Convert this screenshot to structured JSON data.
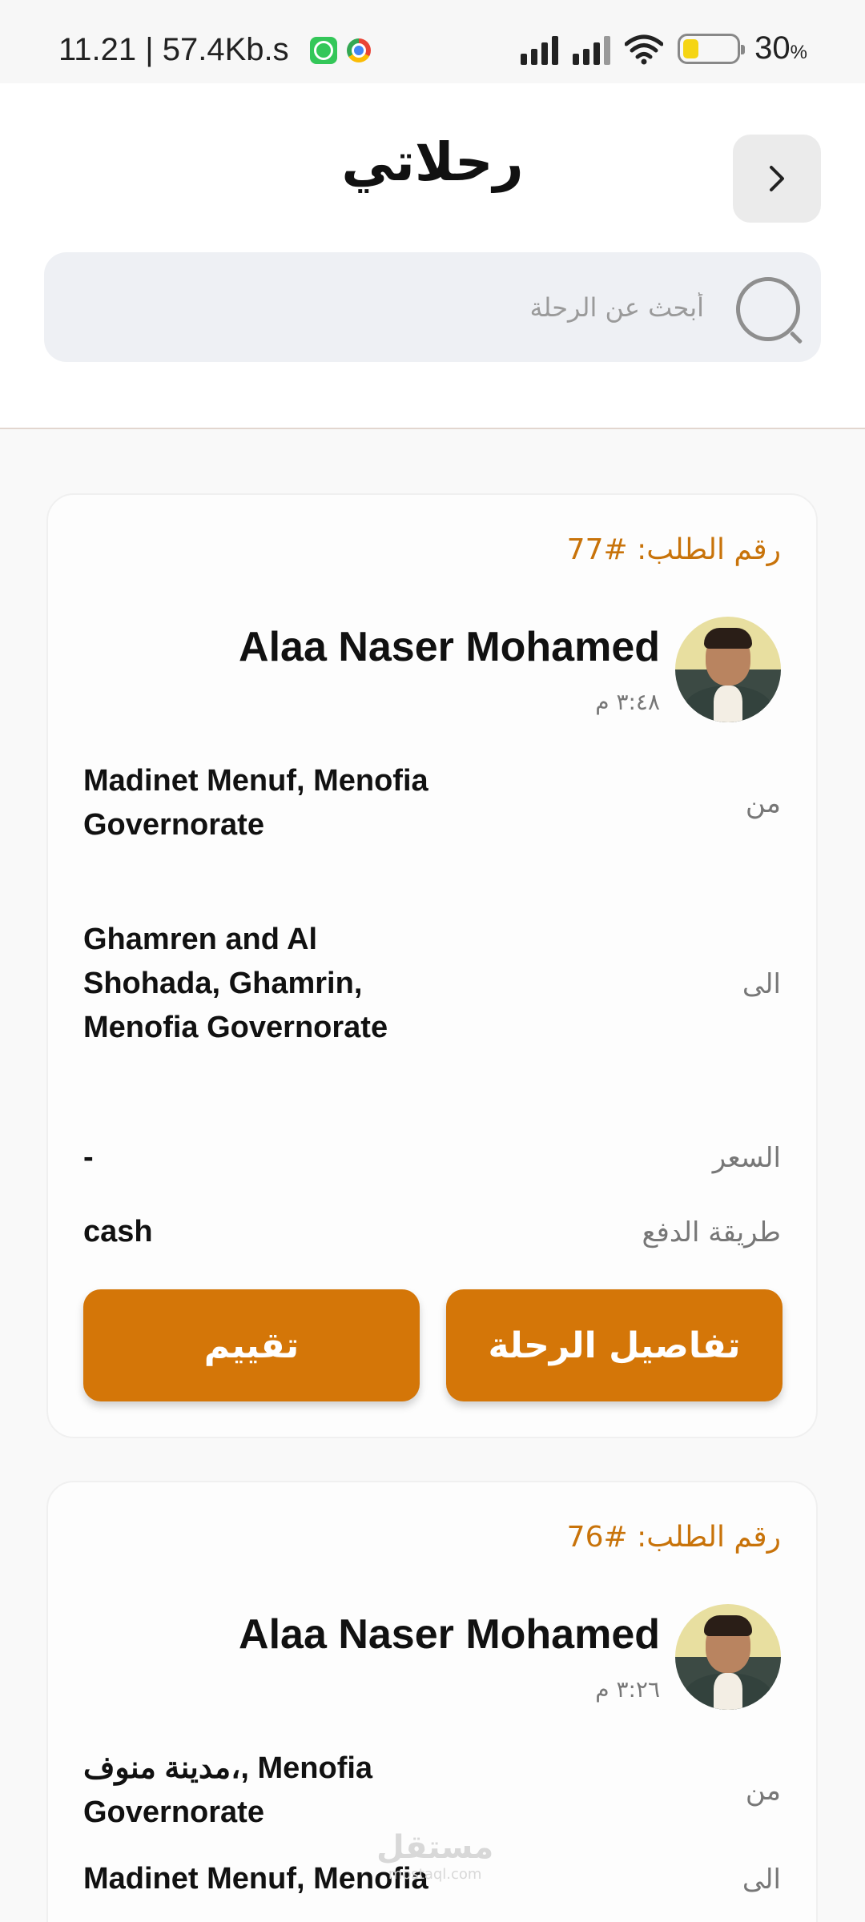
{
  "status_bar": {
    "time_speed": "11.21 | 57.4Kb.s",
    "battery": "30",
    "battery_unit": "%",
    "battery_level": 0.3
  },
  "header": {
    "title": "رحلاتي",
    "back_icon": "chevron-right-icon"
  },
  "search": {
    "placeholder": "أبحث عن الرحلة",
    "icon": "search-icon"
  },
  "trips": [
    {
      "order_number": "رقم الطلب: #77",
      "driver_name": "Alaa Naser Mohamed",
      "time": "٣:٤٨ م",
      "from_label": "من",
      "from_value": "Madinet Menuf, Menofia Governorate",
      "to_label": "الى",
      "to_value": "Ghamren and Al Shohada, Ghamrin, Menofia Governorate",
      "price_label": "السعر",
      "price_value": "-",
      "payment_label": "طريقة الدفع",
      "payment_value": "cash",
      "details_button": "تفاصيل الرحلة",
      "rate_button": "تقييم"
    },
    {
      "order_number": "رقم الطلب: #76",
      "driver_name": "Alaa Naser Mohamed",
      "time": "٣:٢٦ م",
      "from_label": "من",
      "from_value": "مدينة منوف،, Menofia Governorate",
      "to_label": "الى",
      "to_value": "Madinet Menuf, Menofia"
    }
  ],
  "watermark": {
    "arabic": "مستقل",
    "latin": "mostaql.com"
  },
  "colors": {
    "accent": "#d47608",
    "order_text": "#c8730a",
    "search_bg": "#eef0f4"
  }
}
